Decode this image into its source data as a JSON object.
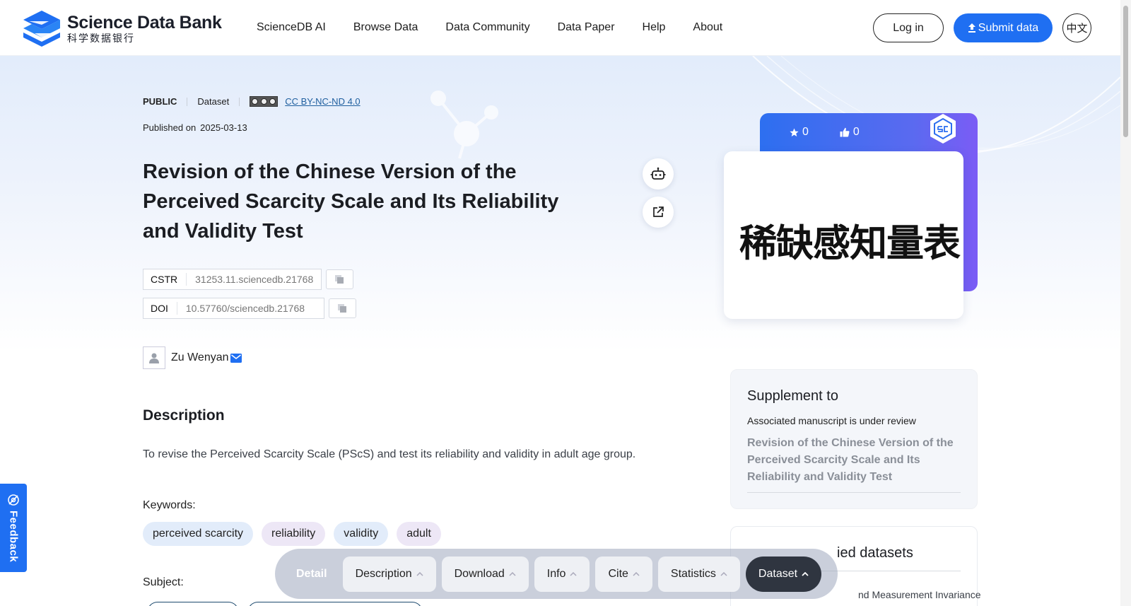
{
  "brand": {
    "name_en": "Science Data Bank",
    "name_zh": "科学数据银行"
  },
  "nav": [
    "ScienceDB AI",
    "Browse Data",
    "Data Community",
    "Data Paper",
    "Help",
    "About"
  ],
  "header_actions": {
    "login": "Log in",
    "submit": "Submit data",
    "lang": "中文"
  },
  "meta": {
    "access": "PUBLIC",
    "type": "Dataset",
    "license": "CC BY-NC-ND 4.0",
    "published_label": "Published on",
    "published_date": "2025-03-13"
  },
  "title": "Revision of the Chinese Version of the Perceived Scarcity Scale and Its Reliability and Validity Test",
  "identifiers": {
    "cstr_label": "CSTR",
    "cstr": "31253.11.sciencedb.21768",
    "doi_label": "DOI",
    "doi": "10.57760/sciencedb.21768"
  },
  "author": {
    "name": "Zu Wenyan"
  },
  "description": {
    "heading": "Description",
    "text": "To revise the Perceived Scarcity Scale (PScS) and test its reliability and validity in adult age group."
  },
  "keywords_label": "Keywords:",
  "keywords": [
    "perceived scarcity",
    "reliability",
    "validity",
    "adult"
  ],
  "subject_label": "Subject:",
  "cover": {
    "stars": "0",
    "likes": "0",
    "text": "稀缺感知量表"
  },
  "supplement": {
    "heading": "Supplement to",
    "status": "Associated manuscript is under review",
    "title": "Revision of the Chinese Version of the Perceived Scarcity Scale and Its Reliability and Validity Test"
  },
  "related": {
    "heading": "ied datasets",
    "item": "nd Measurement Invariance"
  },
  "bottom_nav": {
    "detail": "Detail",
    "items": [
      "Description",
      "Download",
      "Info",
      "Cite",
      "Statistics"
    ],
    "active": "Dataset"
  },
  "feedback": "Feedback",
  "colors": {
    "primary": "#1f6ff2",
    "dark": "#2f3540"
  }
}
